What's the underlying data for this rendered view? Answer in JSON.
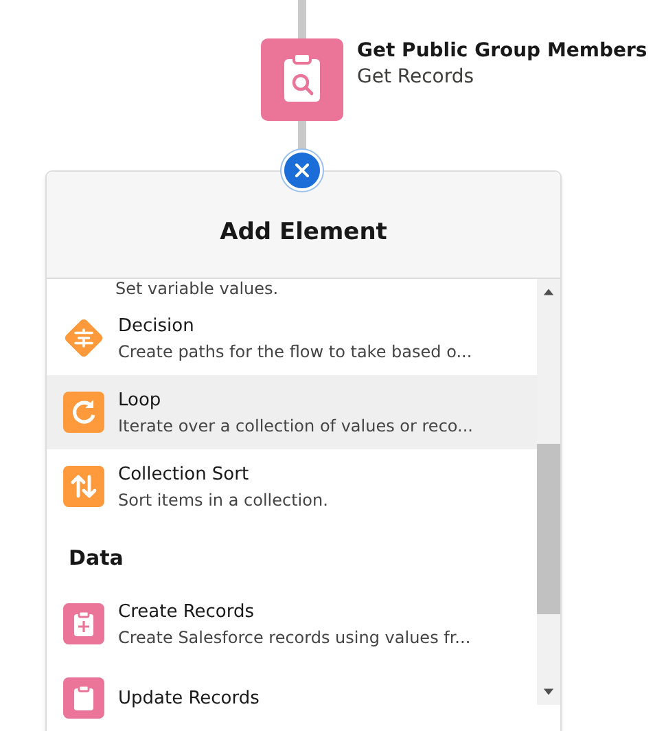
{
  "node": {
    "title": "Get Public Group Members",
    "subtitle": "Get Records",
    "kind": "get-records"
  },
  "panel": {
    "title": "Add Element",
    "items": [
      {
        "kind": "description",
        "description": "Set variable values."
      },
      {
        "kind": "decision",
        "label": "Decision",
        "description": "Create paths for the flow to take based o...",
        "selected": false
      },
      {
        "kind": "loop",
        "label": "Loop",
        "description": "Iterate over a collection of values or reco...",
        "selected": true
      },
      {
        "kind": "sort",
        "label": "Collection Sort",
        "description": "Sort items in a collection.",
        "selected": false
      },
      {
        "kind": "heading",
        "label": "Data"
      },
      {
        "kind": "create-records",
        "label": "Create Records",
        "description": "Create Salesforce records using values fr...",
        "selected": false
      },
      {
        "kind": "update-records",
        "label": "Update Records",
        "selected": false
      }
    ]
  }
}
